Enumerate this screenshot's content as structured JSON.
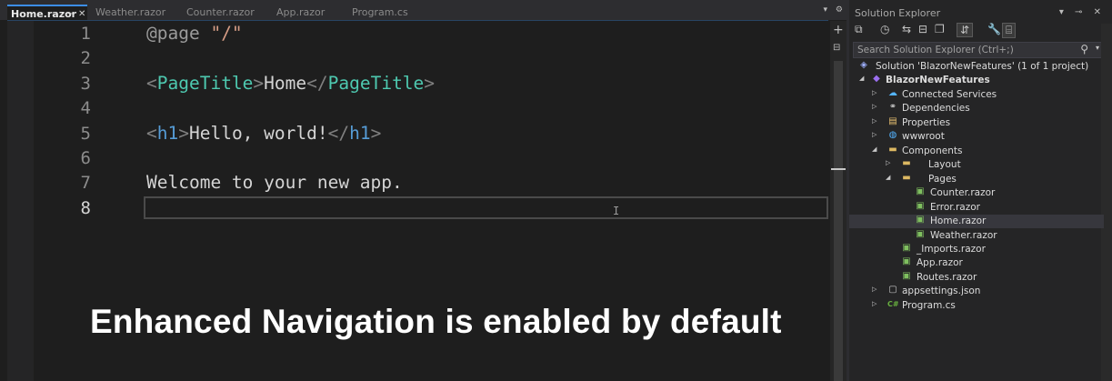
{
  "editor": {
    "tabs": [
      {
        "label": "Home.razor",
        "active": true
      },
      {
        "label": "Weather.razor",
        "active": false
      },
      {
        "label": "Counter.razor",
        "active": false
      },
      {
        "label": "App.razor",
        "active": false
      },
      {
        "label": "Program.cs",
        "active": false
      }
    ],
    "line_numbers": [
      "1",
      "2",
      "3",
      "4",
      "5",
      "6",
      "7",
      "8"
    ],
    "code": {
      "line1": {
        "directive": "@page",
        "string": "\"/\""
      },
      "line3": {
        "open_lt": "<",
        "tag": "PageTitle",
        "open_gt": ">",
        "text": "Home",
        "close_lt": "</",
        "close_tag": "PageTitle",
        "close_gt": ">"
      },
      "line5": {
        "open_lt": "<",
        "tag": "h1",
        "open_gt": ">",
        "text": "Hello, world!",
        "close_lt": "</",
        "close_tag": "h1",
        "close_gt": ">"
      },
      "line7": {
        "text": "Welcome to your new app."
      }
    },
    "current_line": "8"
  },
  "overlay": {
    "caption": "Enhanced Navigation is enabled by default"
  },
  "solution_explorer": {
    "title": "Solution Explorer",
    "search_placeholder": "Search Solution Explorer (Ctrl+;)",
    "tree": [
      {
        "label": "Solution 'BlazorNewFeatures' (1 of 1 project)",
        "icon": "solution-icon",
        "expander": ""
      },
      {
        "label": "BlazorNewFeatures",
        "icon": "project-icon",
        "expander": "expanded",
        "bold": true
      },
      {
        "label": "Connected Services",
        "icon": "connected-services-icon",
        "expander": "collapsed"
      },
      {
        "label": "Dependencies",
        "icon": "dependencies-icon",
        "expander": "collapsed"
      },
      {
        "label": "Properties",
        "icon": "properties-icon",
        "expander": "collapsed"
      },
      {
        "label": "wwwroot",
        "icon": "globe-icon",
        "expander": "collapsed"
      },
      {
        "label": "Components",
        "icon": "folder-icon",
        "expander": "expanded"
      },
      {
        "label": "Layout",
        "icon": "folder-icon",
        "expander": "collapsed"
      },
      {
        "label": "Pages",
        "icon": "folder-icon",
        "expander": "expanded"
      },
      {
        "label": "Counter.razor",
        "icon": "razor-file-icon",
        "expander": ""
      },
      {
        "label": "Error.razor",
        "icon": "razor-file-icon",
        "expander": ""
      },
      {
        "label": "Home.razor",
        "icon": "razor-file-icon",
        "expander": "",
        "selected": true
      },
      {
        "label": "Weather.razor",
        "icon": "razor-file-icon",
        "expander": ""
      },
      {
        "label": "_Imports.razor",
        "icon": "razor-file-icon",
        "expander": ""
      },
      {
        "label": "App.razor",
        "icon": "razor-file-icon",
        "expander": ""
      },
      {
        "label": "Routes.razor",
        "icon": "razor-file-icon",
        "expander": ""
      },
      {
        "label": "appsettings.json",
        "icon": "json-file-icon",
        "expander": "collapsed"
      },
      {
        "label": "Program.cs",
        "icon": "csharp-file-icon",
        "expander": "collapsed"
      }
    ]
  },
  "colors": {
    "editor_bg": "#1e1e1e",
    "tag": "#4ec9b0",
    "html_tag": "#569cd6",
    "string": "#d69d85",
    "accent": "#3c8de6"
  }
}
